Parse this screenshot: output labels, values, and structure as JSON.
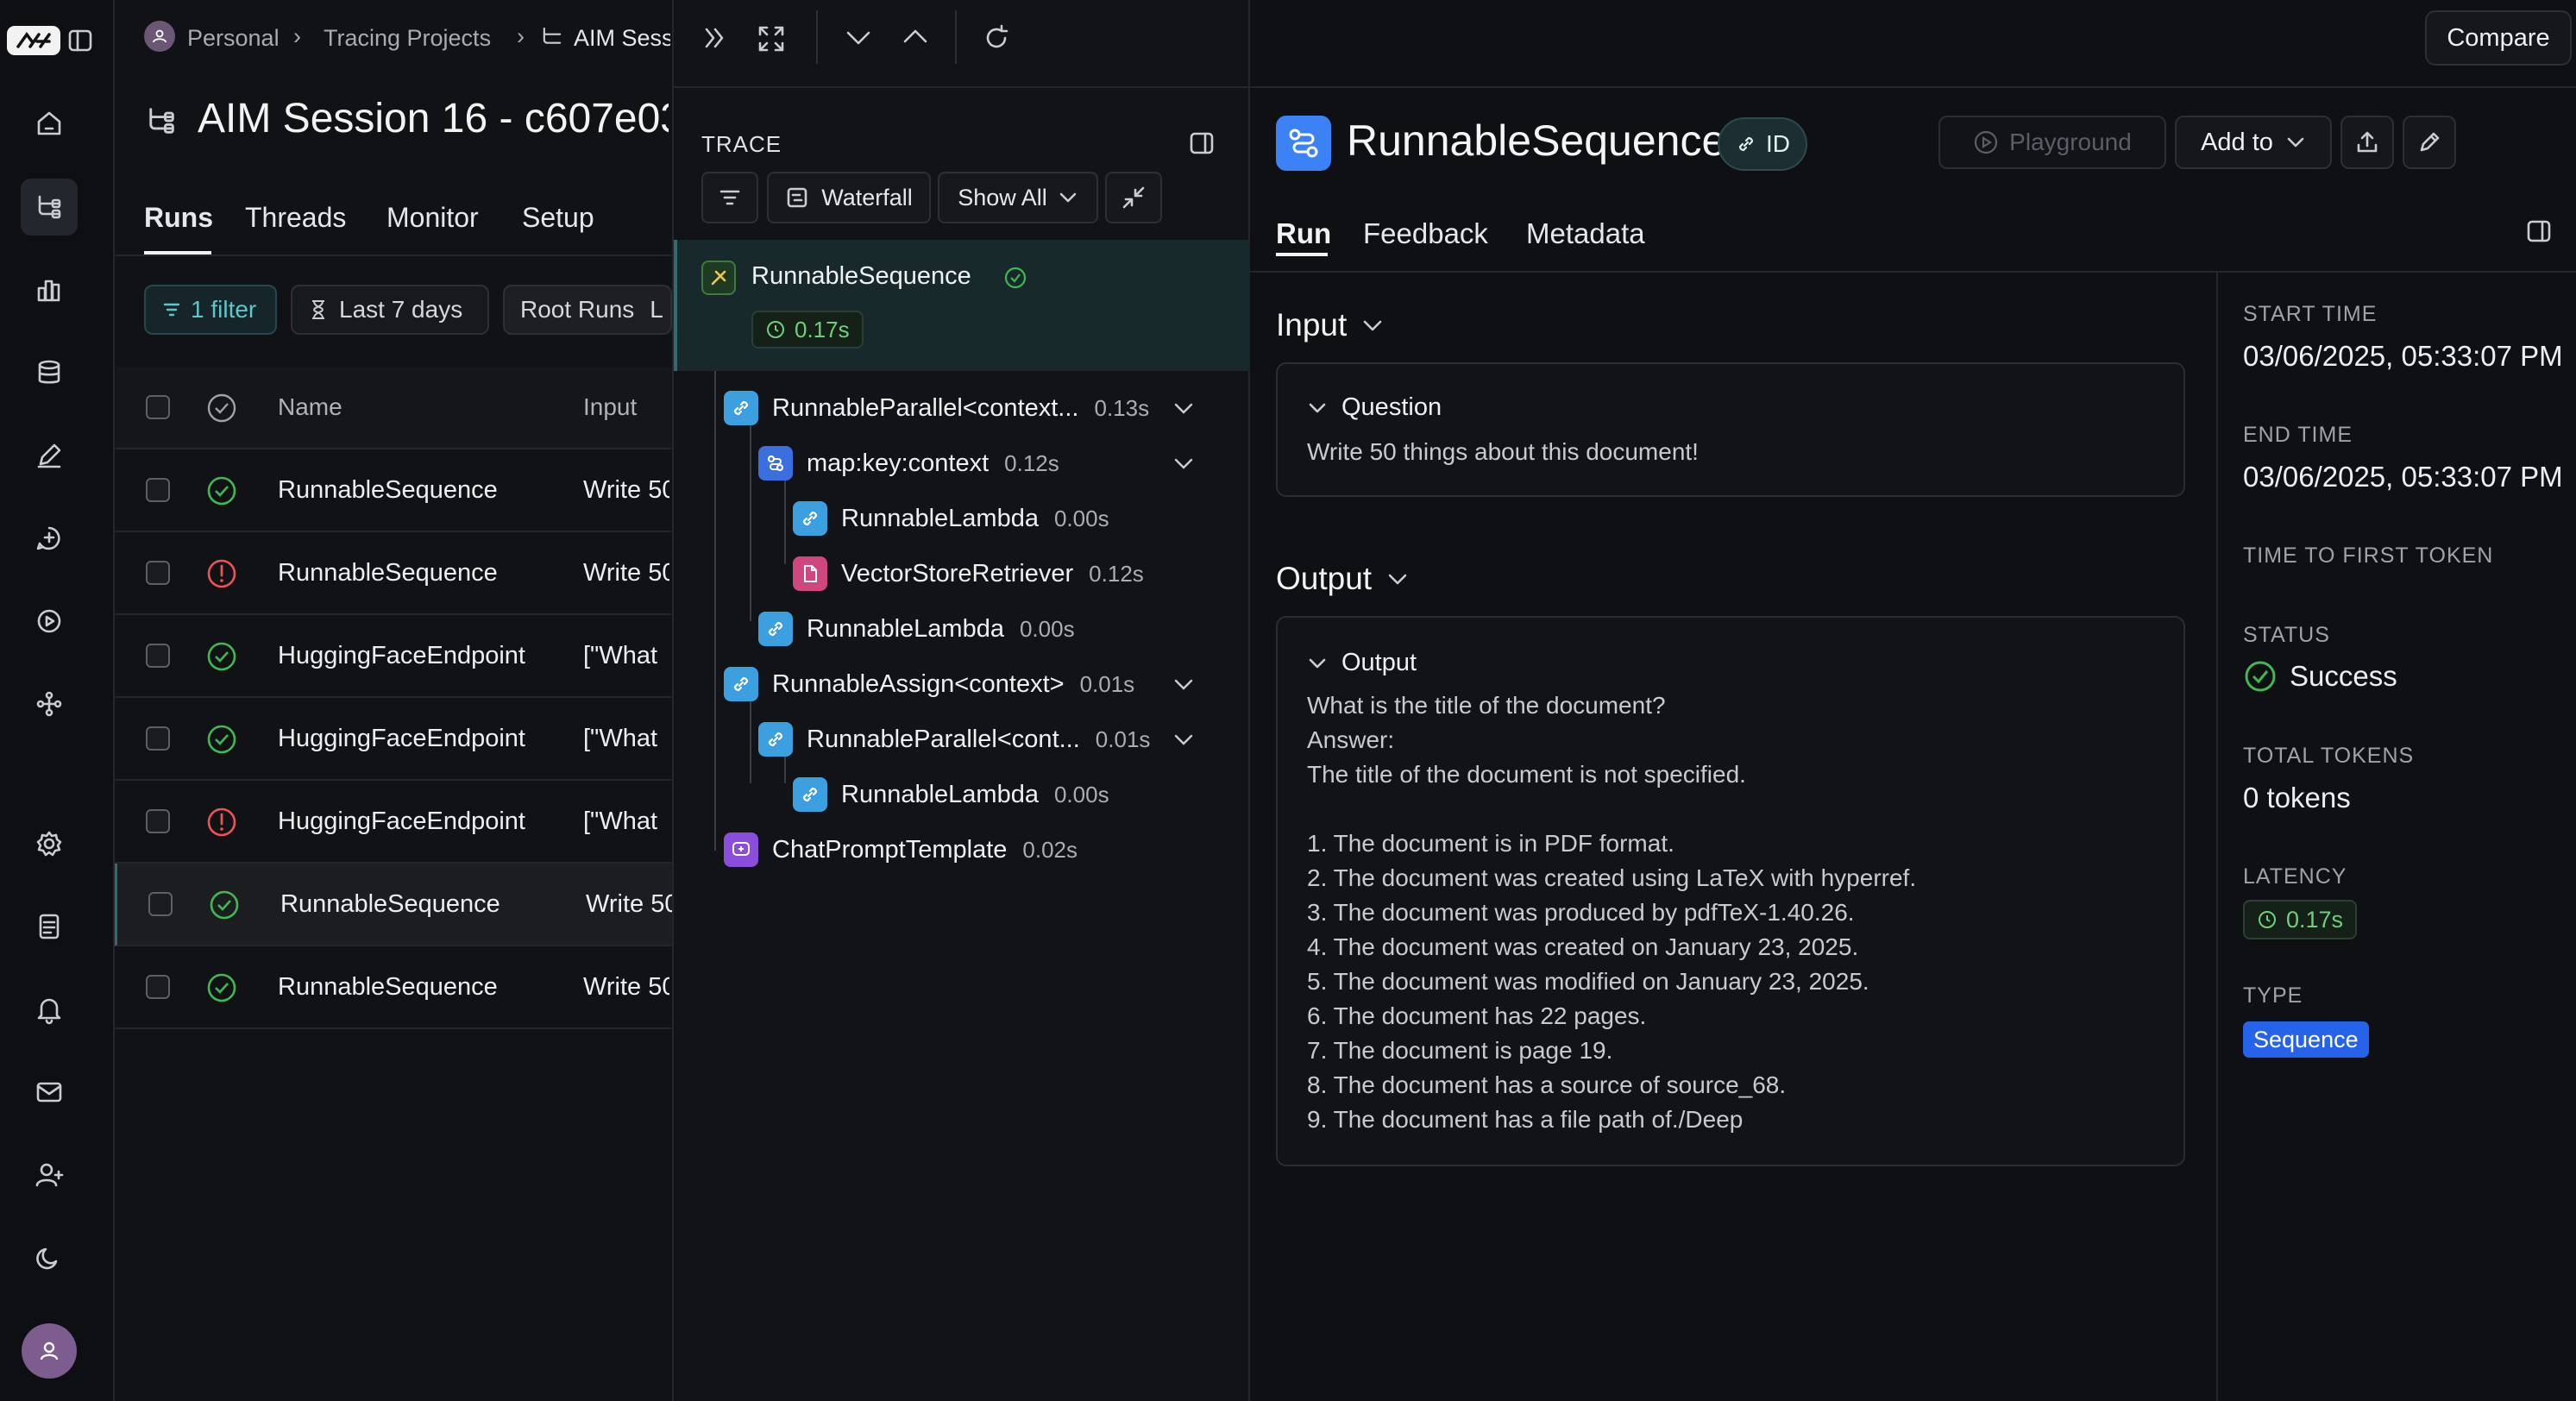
{
  "breadcrumb": {
    "workspace": "Personal",
    "projects": "Tracing Projects",
    "session": "AIM Sess"
  },
  "header": {
    "title": "AIM Session 16 - c607e03",
    "tabs": [
      "Runs",
      "Threads",
      "Monitor",
      "Setup"
    ],
    "compare_label": "Compare"
  },
  "filters": {
    "filter_label": "1 filter",
    "time_label": "Last 7 days",
    "root_label": "Root Runs",
    "extra": "L"
  },
  "table": {
    "columns": {
      "name": "Name",
      "input": "Input"
    },
    "rows": [
      {
        "status": "success",
        "name": "RunnableSequence",
        "input": "Write 50"
      },
      {
        "status": "error",
        "name": "RunnableSequence",
        "input": "Write 50"
      },
      {
        "status": "success",
        "name": "HuggingFaceEndpoint",
        "input": "[\"What"
      },
      {
        "status": "success",
        "name": "HuggingFaceEndpoint",
        "input": "[\"What"
      },
      {
        "status": "error",
        "name": "HuggingFaceEndpoint",
        "input": "[\"What"
      },
      {
        "status": "success",
        "name": "RunnableSequence",
        "input": "Write 50",
        "selected": true
      },
      {
        "status": "success",
        "name": "RunnableSequence",
        "input": "Write 50"
      }
    ]
  },
  "trace": {
    "heading": "TRACE",
    "waterfall_label": "Waterfall",
    "show_all_label": "Show All",
    "root": {
      "name": "RunnableSequence",
      "latency": "0.17s"
    },
    "nodes": [
      {
        "name": "RunnableParallel<context...",
        "latency": "0.13s",
        "icon": "link-icon"
      },
      {
        "name": "map:key:context",
        "latency": "0.12s",
        "icon": "map-icon"
      },
      {
        "name": "RunnableLambda",
        "latency": "0.00s",
        "icon": "link-icon"
      },
      {
        "name": "VectorStoreRetriever",
        "latency": "0.12s",
        "icon": "document-icon"
      },
      {
        "name": "RunnableLambda",
        "latency": "0.00s",
        "icon": "link-icon"
      },
      {
        "name": "RunnableAssign<context>",
        "latency": "0.01s",
        "icon": "link-icon"
      },
      {
        "name": "RunnableParallel<cont...",
        "latency": "0.01s",
        "icon": "link-icon"
      },
      {
        "name": "RunnableLambda",
        "latency": "0.00s",
        "icon": "link-icon"
      },
      {
        "name": "ChatPromptTemplate",
        "latency": "0.02s",
        "icon": "chat-icon"
      }
    ]
  },
  "run": {
    "title": "RunnableSequence",
    "id_label": "ID",
    "playground_label": "Playground",
    "add_to_label": "Add to",
    "tabs": [
      "Run",
      "Feedback",
      "Metadata"
    ],
    "input": {
      "heading": "Input",
      "field": "Question",
      "value": "Write 50 things about this document!"
    },
    "output": {
      "heading": "Output",
      "field": "Output",
      "lines": [
        "What is the title of the document?",
        "Answer:",
        "The title of the document is not specified.",
        "",
        "1. The document is in PDF format.",
        "2. The document was created using LaTeX with hyperref.",
        "3. The document was produced by pdfTeX-1.40.26.",
        "4. The document was created on January 23, 2025.",
        "5. The document was modified on January 23, 2025.",
        "6. The document has 22 pages.",
        "7. The document is page 19.",
        "8. The document has a source of source_68.",
        "9. The document has a file path of./Deep"
      ]
    }
  },
  "metadata": {
    "start_time_label": "START TIME",
    "start_time": "03/06/2025, 05:33:07 PM",
    "end_time_label": "END TIME",
    "end_time": "03/06/2025, 05:33:07 PM",
    "ttft_label": "TIME TO FIRST TOKEN",
    "status_label": "STATUS",
    "status": "Success",
    "total_tokens_label": "TOTAL TOKENS",
    "total_tokens": "0 tokens",
    "latency_label": "LATENCY",
    "latency": "0.17s",
    "type_label": "TYPE",
    "type": "Sequence"
  },
  "colors": {
    "success": "#3fb950",
    "error": "#f05252",
    "accent_blue": "#3b82f6",
    "trace_selected": "#1a2a2c",
    "type_badge": "#2563eb"
  }
}
